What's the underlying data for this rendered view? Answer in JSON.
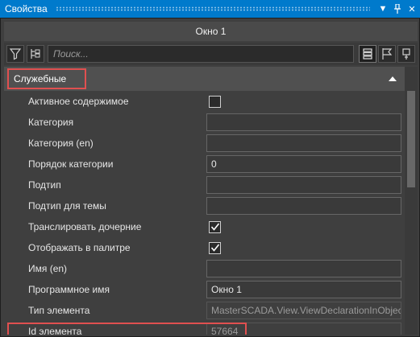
{
  "window": {
    "title": "Свойства"
  },
  "header": {
    "object_name": "Окно 1"
  },
  "toolbar": {
    "search_placeholder": "Поиск..."
  },
  "category": {
    "label": "Служебные"
  },
  "rows": [
    {
      "name": "Активное содержимое",
      "type": "checkbox",
      "checked": false
    },
    {
      "name": "Категория",
      "type": "text",
      "value": ""
    },
    {
      "name": "Категория (en)",
      "type": "text",
      "value": ""
    },
    {
      "name": "Порядок категории",
      "type": "text",
      "value": "0"
    },
    {
      "name": "Подтип",
      "type": "text",
      "value": ""
    },
    {
      "name": "Подтип для темы",
      "type": "text",
      "value": ""
    },
    {
      "name": "Транслировать дочерние",
      "type": "checkbox",
      "checked": true
    },
    {
      "name": "Отображать в палитре",
      "type": "checkbox",
      "checked": true
    },
    {
      "name": "Имя (en)",
      "type": "text",
      "value": ""
    },
    {
      "name": "Программное имя",
      "type": "text",
      "value": "Окно 1"
    },
    {
      "name": "Тип элемента",
      "type": "readonly",
      "value": "MasterSCADA.View.ViewDeclarationInObject"
    },
    {
      "name": "Id элемента",
      "type": "readonly",
      "value": "57664"
    }
  ],
  "colors": {
    "accent": "#007acc",
    "highlight": "#e05050"
  }
}
